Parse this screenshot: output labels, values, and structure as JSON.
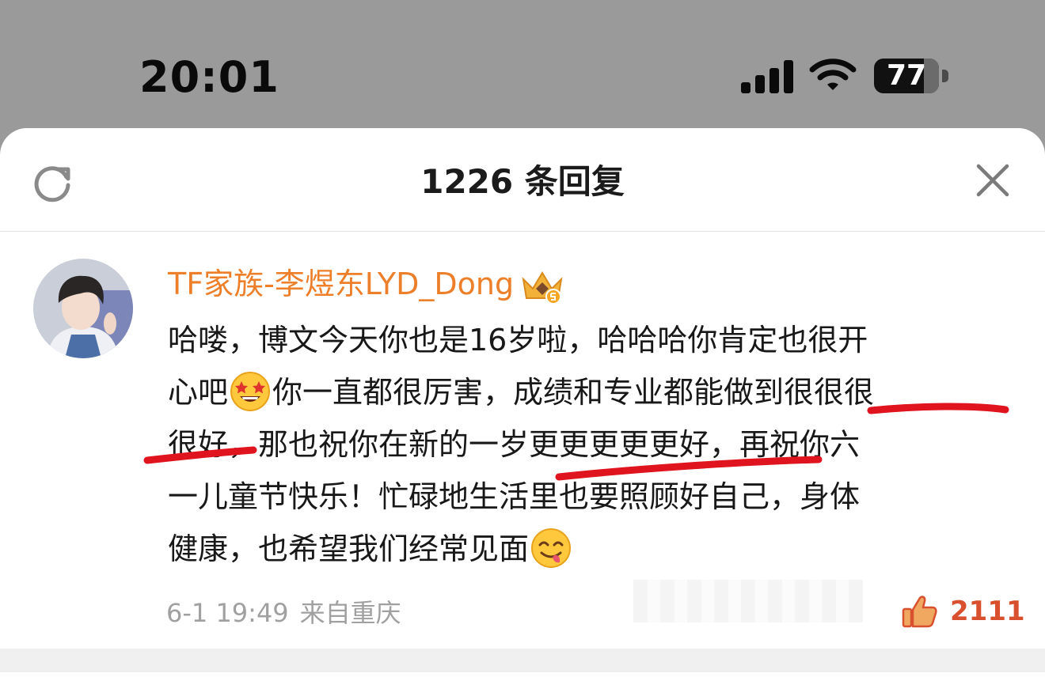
{
  "status_bar": {
    "time": "20:01",
    "battery_level": 77,
    "battery_text": "77",
    "icons": [
      "cellular-signal-icon",
      "wifi-icon",
      "battery-icon"
    ]
  },
  "header": {
    "title": "1226 条回复",
    "left_icon": "refresh-icon",
    "right_icon": "close-icon"
  },
  "comment": {
    "author": "TF家族-李煜东LYD_Dong",
    "badge_icon": "crown-badge-icon",
    "lines": [
      {
        "text": "哈喽，博文今天你也是16岁啦，哈哈哈你肯定也很开"
      },
      {
        "before": "心吧",
        "emoji": "star-struck-emoji",
        "after": "你一直都很厉害，成绩和专业都能做到很很很"
      },
      {
        "text": "很好，那也祝你在新的一岁更更更更更好，再祝你六"
      },
      {
        "text": "一儿童节快乐！忙碌地生活里也要照顾好自己，身体"
      },
      {
        "before": "健康，也希望我们经常见面",
        "emoji": "yum-face-emoji",
        "after": ""
      }
    ],
    "timestamp": "6-1 19:49",
    "location": "来自重庆",
    "like_count": "2111",
    "like_icon": "thumbs-up-icon"
  },
  "colors": {
    "author": "#ee7f2a",
    "like": "#d9502f",
    "annotation": "#e0141e",
    "meta": "#a0a0a0"
  }
}
